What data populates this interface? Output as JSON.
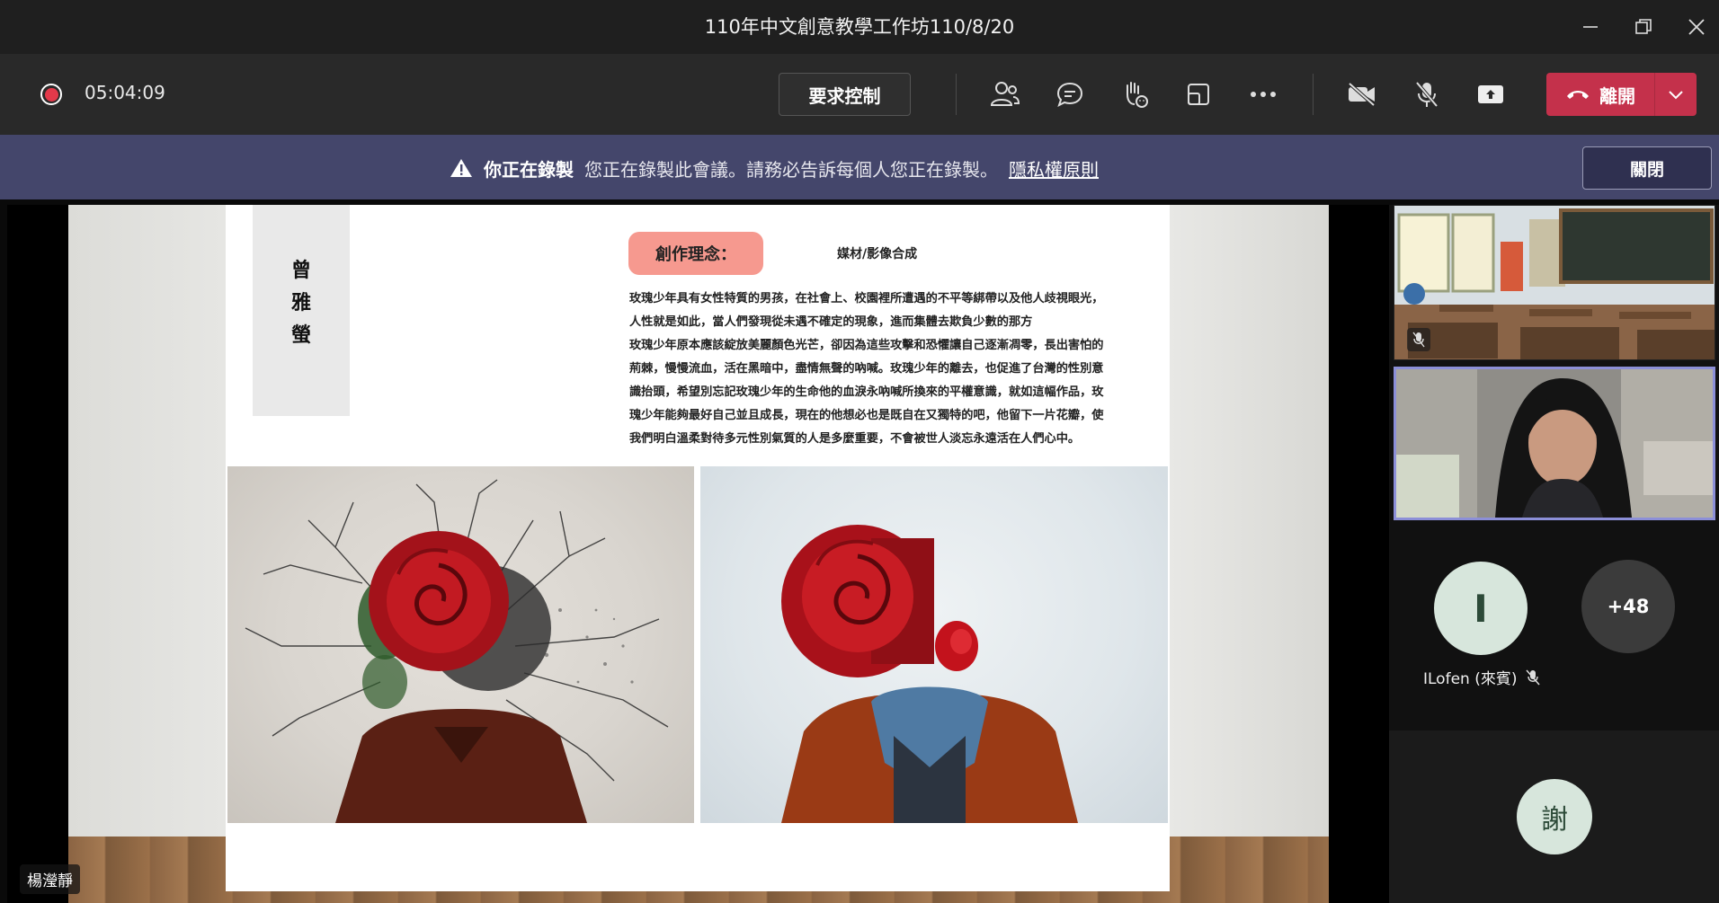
{
  "window": {
    "title": "110年中文創意教學工作坊110/8/20"
  },
  "toolbar": {
    "timer": "05:04:09",
    "request_control_label": "要求控制",
    "leave_label": "離開"
  },
  "banner": {
    "bold_text": "你正在錄製",
    "message": "您正在錄製此會議。請務必告訴每個人您正在錄製。",
    "privacy_link": "隱私權原則",
    "close_label": "關閉"
  },
  "slide": {
    "author_chars": [
      "曾",
      "雅",
      "螢"
    ],
    "concept_label": "創作理念：",
    "medium": "媒材/影像合成",
    "paragraph_lines": [
      "玫瑰少年具有女性特質的男孩，在社會上、校園裡所遭遇的不平等綁帶以及他人歧視眼光，",
      "人性就是如此，當人們發現從未遇不確定的現象，進而集體去欺負少數的那方",
      "玫瑰少年原本應該綻放美麗顏色光芒，卻因為這些攻擊和恐懼讓自己逐漸凋零，長出害怕的",
      "荊棘，慢慢流血，活在黑暗中，盡情無聲的吶喊。玫瑰少年的離去，也促進了台灣的性別意",
      "識抬頭，希望別忘記玫瑰少年的生命他的血淚永吶喊所換來的平權意識，就如這幅作品，玫",
      "瑰少年能夠最好自己並且成長，現在的他想必也是既自在又獨特的吧，他留下一片花瓣，使",
      "我們明白溫柔對待多元性別氣質的人是多麼重要，不會被世人淡忘永遠活在人們心中。"
    ]
  },
  "participants": {
    "avatar_initial": "I",
    "overflow_count": "+48",
    "guest_name": "ILofen (來賓)",
    "bottom_avatar": "謝"
  },
  "speaker_label": "楊瀅靜",
  "colors": {
    "leave_red": "#c4314b",
    "banner_purple": "#44466b",
    "highlight_border": "#8c8fd8",
    "concept_pill": "#f6998f"
  }
}
